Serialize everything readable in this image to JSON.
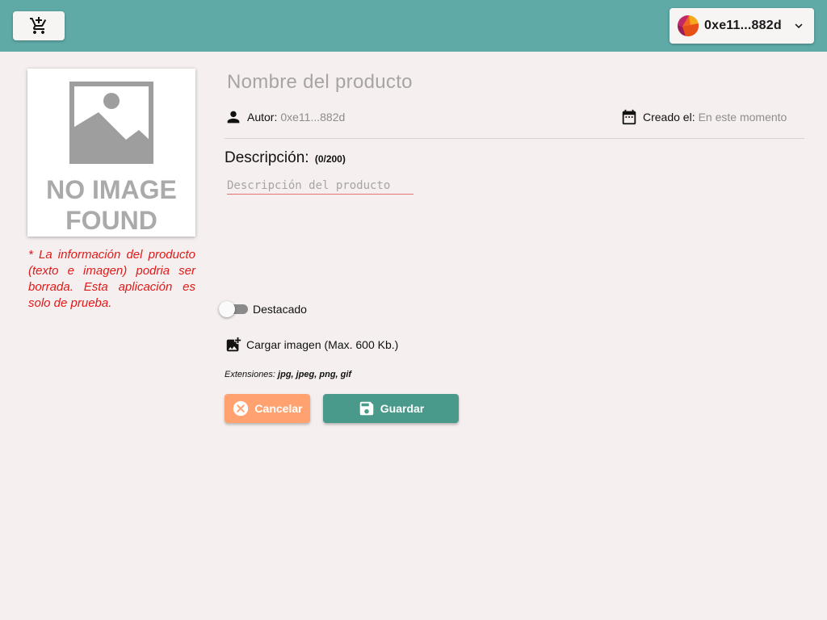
{
  "header": {
    "account_label": "0xe11...882d",
    "bg_color": "#5faaa7"
  },
  "image_placeholder": {
    "line1": "NO IMAGE",
    "line2": "FOUND"
  },
  "warning": "* La información del producto (texto e imagen) podria ser borrada. Esta aplicación es solo de prueba.",
  "product": {
    "name_placeholder": "Nombre del producto",
    "author_key": "Autor:",
    "author_value": "0xe11...882d",
    "created_key": "Creado el:",
    "created_value": "En este momento"
  },
  "description": {
    "title": "Descripción:",
    "count": "(0/200)",
    "placeholder": "Descripción del producto"
  },
  "featured": {
    "label": "Destacado",
    "enabled": false
  },
  "upload": {
    "label": "Cargar imagen (Max. 600 Kb.)"
  },
  "extensions": {
    "label": "Extensiones:",
    "value": "jpg, jpeg, png, gif"
  },
  "actions": {
    "cancel_label": "Cancelar",
    "save_label": "Guardar",
    "cancel_color": "#ffa270",
    "save_color": "#4a9a8b"
  },
  "icons": [
    "add-shopping-cart-icon",
    "chevron-down-icon",
    "person-icon",
    "calendar-icon",
    "add-photo-icon",
    "cancel-circle-icon",
    "save-icon"
  ]
}
